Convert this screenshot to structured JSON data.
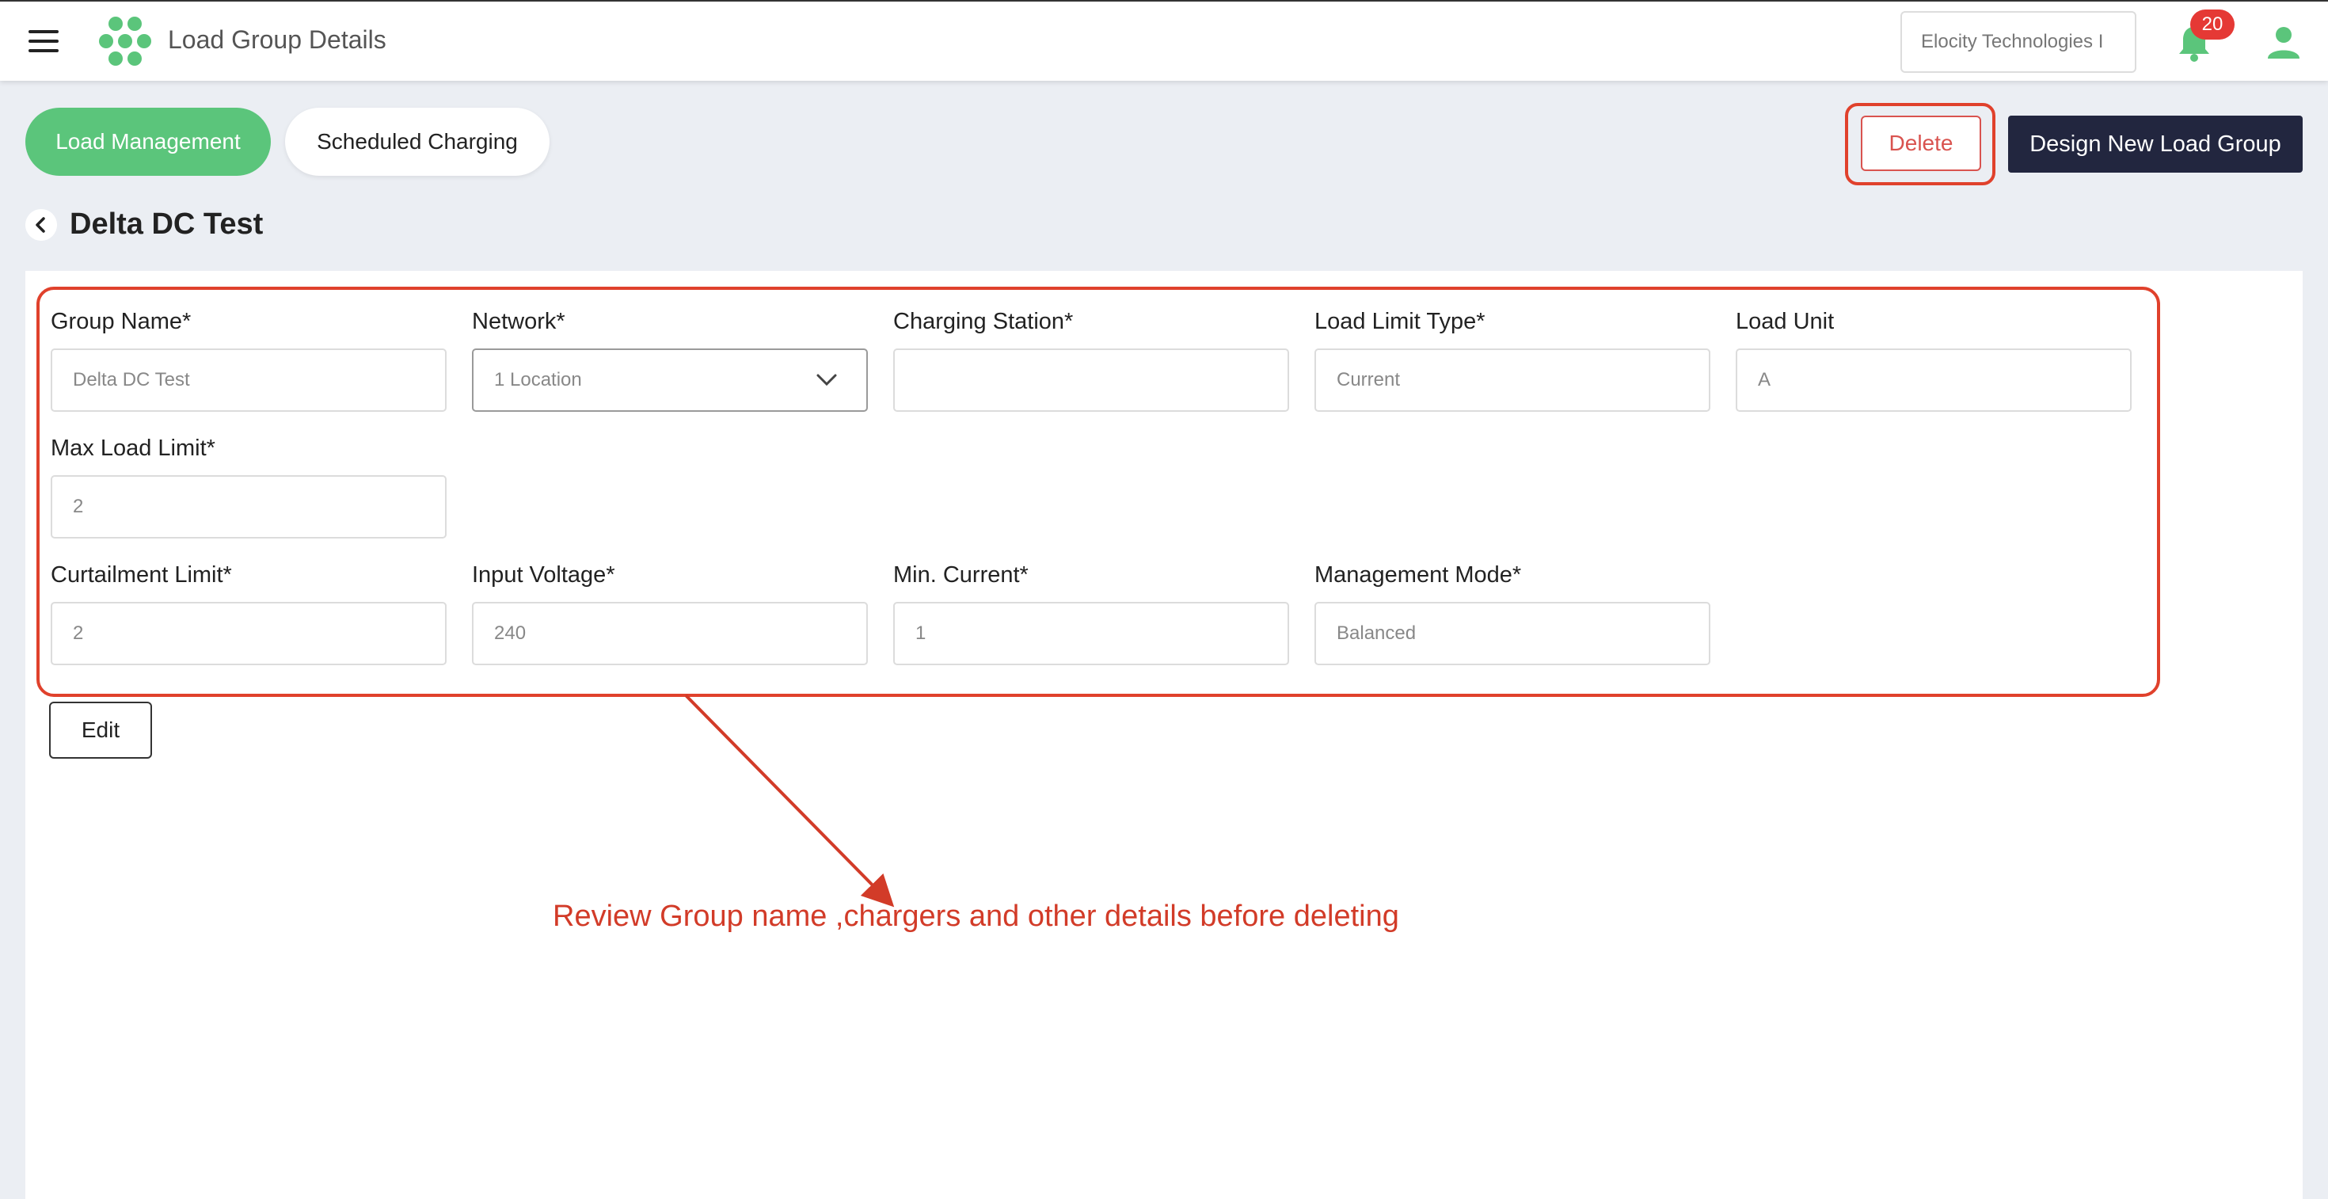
{
  "header": {
    "title": "Load Group Details",
    "organization": "Elocity Technologies I",
    "notification_count": "20"
  },
  "tabs": [
    {
      "label": "Load Management",
      "active": true
    },
    {
      "label": "Scheduled Charging",
      "active": false
    }
  ],
  "actions": {
    "delete_label": "Delete",
    "design_label": "Design New Load Group"
  },
  "page": {
    "title": "Delta DC Test"
  },
  "form": {
    "group_name": {
      "label": "Group Name*",
      "value": "Delta DC Test"
    },
    "network": {
      "label": "Network*",
      "value": "1 Location"
    },
    "charging_station": {
      "label": "Charging Station*",
      "value": ""
    },
    "load_limit_type": {
      "label": "Load Limit Type*",
      "value": "Current"
    },
    "load_unit": {
      "label": "Load Unit",
      "value": "A"
    },
    "max_load_limit": {
      "label": "Max Load Limit*",
      "value": "2"
    },
    "curtailment_limit": {
      "label": "Curtailment Limit*",
      "value": "2"
    },
    "input_voltage": {
      "label": "Input Voltage*",
      "value": "240"
    },
    "min_current": {
      "label": "Min. Current*",
      "value": "1"
    },
    "management_mode": {
      "label": "Management Mode*",
      "value": "Balanced"
    },
    "edit_label": "Edit"
  },
  "annotation": {
    "text": "Review Group name ,chargers and other details before deleting",
    "color": "#d23b28"
  },
  "colors": {
    "accent_green": "#5bc57b",
    "dark_navy": "#22263f",
    "danger_red": "#d9534f"
  }
}
